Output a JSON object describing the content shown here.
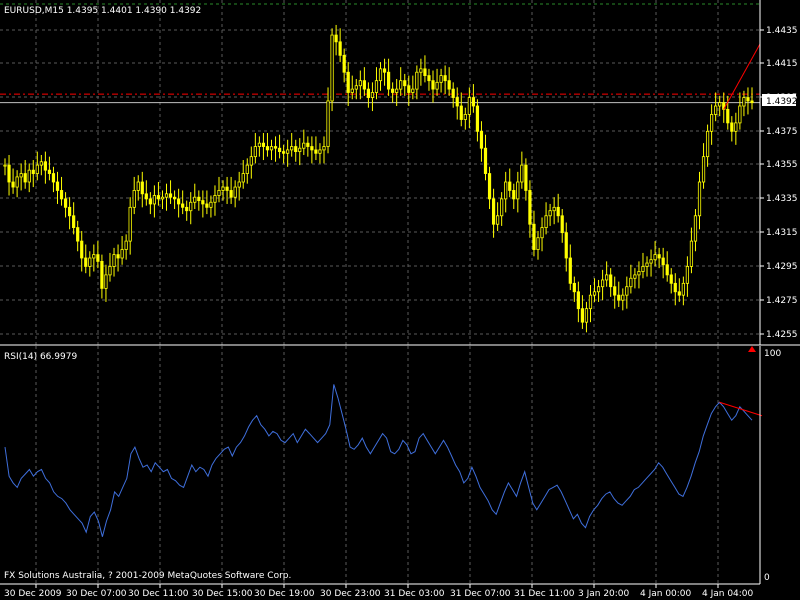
{
  "window": {
    "symbol_header": "EURUSD,M15  1.4395 1.4401 1.4390 1.4392",
    "rsi_header": "RSI(14) 66.9979",
    "copyright": "FX Solutions Australia, ? 2001-2009 MetaQuotes Software Corp.",
    "current_price_label": "1.4392"
  },
  "colors": {
    "background": "#000000",
    "grid": "#5a5a5a",
    "candle": "#ffff00",
    "rsi_line": "#3f6fdc",
    "trendline": "#ff0000",
    "price_line": "#c0c0c0",
    "text": "#ffffff"
  },
  "icons": {
    "rsi_upper_marker": "arrow-up-marker"
  },
  "chart_data": [
    {
      "type": "candlestick",
      "title": "EURUSD,M15  1.4395 1.4401 1.4390 1.4392",
      "symbol": "EURUSD",
      "timeframe": "M15",
      "ohlc_last": {
        "open": 1.4395,
        "high": 1.4401,
        "low": 1.439,
        "close": 1.4392
      },
      "y_ticks": [
        "1.4435",
        "1.4415",
        "1.4395",
        "1.4375",
        "1.4355",
        "1.4335",
        "1.4315",
        "1.4295",
        "1.4275",
        "1.4255"
      ],
      "ylim": [
        1.4248,
        1.4447
      ],
      "x_ticks": [
        "30 Dec 2009",
        "30 Dec 07:00",
        "30 Dec 11:00",
        "30 Dec 15:00",
        "30 Dec 19:00",
        "30 Dec 23:00",
        "31 Dec 03:00",
        "31 Dec 07:00",
        "31 Dec 11:00",
        "3 Jan 20:00",
        "4 Jan 00:00",
        "4 Jan 04:00"
      ],
      "current_price": 1.4392,
      "resistance_level": 1.4397,
      "grid": true,
      "closes": [
        1.4355,
        1.4345,
        1.4342,
        1.4348,
        1.435,
        1.4345,
        1.4352,
        1.435,
        1.4355,
        1.4357,
        1.4352,
        1.435,
        1.4345,
        1.434,
        1.4335,
        1.433,
        1.4325,
        1.4318,
        1.431,
        1.43,
        1.4295,
        1.43,
        1.4302,
        1.4298,
        1.4282,
        1.429,
        1.4295,
        1.4302,
        1.43,
        1.4305,
        1.431,
        1.433,
        1.434,
        1.4345,
        1.4338,
        1.4335,
        1.4332,
        1.4337,
        1.4335,
        1.4336,
        1.4338,
        1.4336,
        1.4335,
        1.4332,
        1.433,
        1.4328,
        1.4333,
        1.4336,
        1.4334,
        1.4332,
        1.433,
        1.4333,
        1.4337,
        1.434,
        1.4342,
        1.434,
        1.4336,
        1.4342,
        1.4345,
        1.435,
        1.4355,
        1.436,
        1.4366,
        1.4368,
        1.4366,
        1.4364,
        1.4366,
        1.4365,
        1.4363,
        1.4362,
        1.4364,
        1.4366,
        1.4363,
        1.4365,
        1.4368,
        1.4366,
        1.4364,
        1.4362,
        1.4364,
        1.4366,
        1.4393,
        1.4432,
        1.4428,
        1.442,
        1.441,
        1.4398,
        1.44,
        1.4402,
        1.4405,
        1.44,
        1.4395,
        1.4398,
        1.4405,
        1.4412,
        1.441,
        1.44,
        1.4398,
        1.44,
        1.4405,
        1.4402,
        1.4398,
        1.44,
        1.441,
        1.4412,
        1.4408,
        1.4405,
        1.44,
        1.4404,
        1.4408,
        1.4405,
        1.44,
        1.4395,
        1.439,
        1.4382,
        1.4385,
        1.4395,
        1.439,
        1.4375,
        1.4365,
        1.435,
        1.4335,
        1.432,
        1.4325,
        1.4335,
        1.4345,
        1.434,
        1.4335,
        1.4345,
        1.4355,
        1.434,
        1.432,
        1.4305,
        1.4312,
        1.4318,
        1.4325,
        1.4328,
        1.433,
        1.4325,
        1.4315,
        1.43,
        1.4285,
        1.428,
        1.427,
        1.4262,
        1.427,
        1.4278,
        1.428,
        1.4283,
        1.4287,
        1.429,
        1.4283,
        1.4278,
        1.4275,
        1.4278,
        1.4283,
        1.4288,
        1.429,
        1.4292,
        1.4295,
        1.4297,
        1.4299,
        1.4302,
        1.43,
        1.4296,
        1.429,
        1.4285,
        1.428,
        1.4278,
        1.4285,
        1.4295,
        1.431,
        1.4325,
        1.4345,
        1.436,
        1.4375,
        1.4385,
        1.439,
        1.4392,
        1.4388,
        1.438,
        1.4375,
        1.438,
        1.439,
        1.4395,
        1.4393,
        1.4392
      ]
    },
    {
      "type": "line",
      "title": "RSI(14) 66.9979",
      "series": [
        {
          "name": "RSI(14)",
          "last": 66.9979
        }
      ],
      "y_ticks": [
        "100",
        "0"
      ],
      "ylim": [
        0,
        100
      ],
      "grid": true,
      "values": [
        58,
        45,
        42,
        40,
        44,
        46,
        48,
        45,
        47,
        48,
        44,
        42,
        38,
        36,
        35,
        33,
        30,
        28,
        26,
        24,
        20,
        27,
        29,
        25,
        18,
        25,
        30,
        38,
        36,
        40,
        44,
        55,
        58,
        53,
        49,
        50,
        47,
        51,
        49,
        47,
        48,
        44,
        43,
        41,
        40,
        45,
        50,
        47,
        49,
        48,
        45,
        50,
        53,
        55,
        57,
        58,
        54,
        58,
        60,
        63,
        67,
        70,
        72,
        68,
        66,
        63,
        65,
        64,
        61,
        60,
        62,
        64,
        60,
        63,
        66,
        64,
        62,
        60,
        62,
        64,
        68,
        86,
        80,
        73,
        66,
        58,
        57,
        59,
        62,
        58,
        55,
        58,
        61,
        64,
        62,
        56,
        55,
        57,
        61,
        59,
        55,
        56,
        62,
        64,
        61,
        58,
        55,
        58,
        61,
        58,
        54,
        50,
        47,
        42,
        44,
        49,
        45,
        40,
        37,
        34,
        30,
        28,
        33,
        38,
        42,
        39,
        36,
        42,
        47,
        40,
        33,
        30,
        33,
        36,
        39,
        40,
        41,
        38,
        34,
        30,
        26,
        28,
        24,
        22,
        27,
        30,
        32,
        35,
        37,
        38,
        35,
        33,
        32,
        34,
        36,
        39,
        40,
        42,
        44,
        46,
        48,
        51,
        49,
        46,
        43,
        40,
        37,
        36,
        40,
        45,
        51,
        56,
        63,
        68,
        73,
        76,
        78,
        76,
        73,
        70,
        72,
        76,
        74,
        72,
        70
      ],
      "trendline": {
        "from": 78,
        "to": 72
      }
    }
  ]
}
